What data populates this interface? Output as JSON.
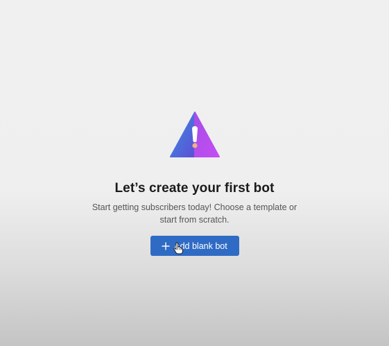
{
  "empty_state": {
    "logo": "triangle-exclamation-logo",
    "title": "Let’s create your first bot",
    "subtitle": "Start getting subscribers today! Choose a template or start from scratch.",
    "button_label": "Add blank bot",
    "button_icon": "plus-icon",
    "pointer_icon": "hand-pointer-icon"
  },
  "colors": {
    "accent": "#2f6bc4",
    "logo_blue": "#4f63d8",
    "logo_purple": "#b94df0",
    "background": "#f0f0f0"
  }
}
